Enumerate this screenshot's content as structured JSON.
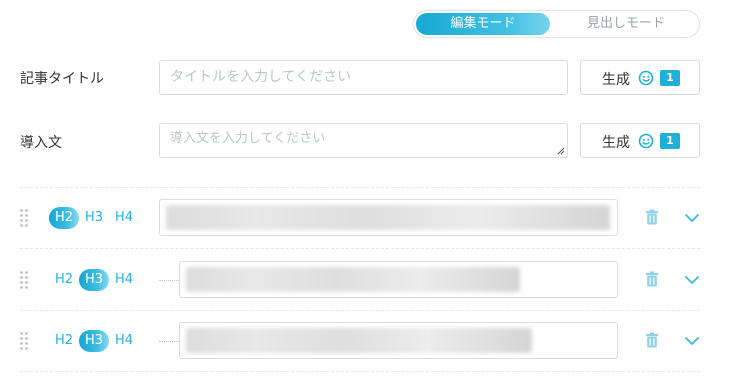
{
  "mode_toggle": {
    "edit_label": "編集モード",
    "heading_label": "見出しモード",
    "active": "edit"
  },
  "title_field": {
    "label": "記事タイトル",
    "placeholder": "タイトルを入力してください",
    "generate_label": "生成",
    "generate_count": "1"
  },
  "intro_field": {
    "label": "導入文",
    "placeholder": "導入文を入力してください",
    "generate_label": "生成",
    "generate_count": "1"
  },
  "headings": [
    {
      "level": "H2",
      "levels": [
        "H2",
        "H3",
        "H4"
      ]
    },
    {
      "level": "H3",
      "levels": [
        "H2",
        "H3",
        "H4"
      ]
    },
    {
      "level": "H3",
      "levels": [
        "H2",
        "H3",
        "H4"
      ]
    }
  ],
  "colors": {
    "accent": "#1eb0d8",
    "border": "#d7dde0",
    "placeholder": "#bfc5c8"
  },
  "icons": [
    "drag-handle-icon",
    "trash-icon",
    "chevron-down-icon",
    "ai-face-icon"
  ]
}
